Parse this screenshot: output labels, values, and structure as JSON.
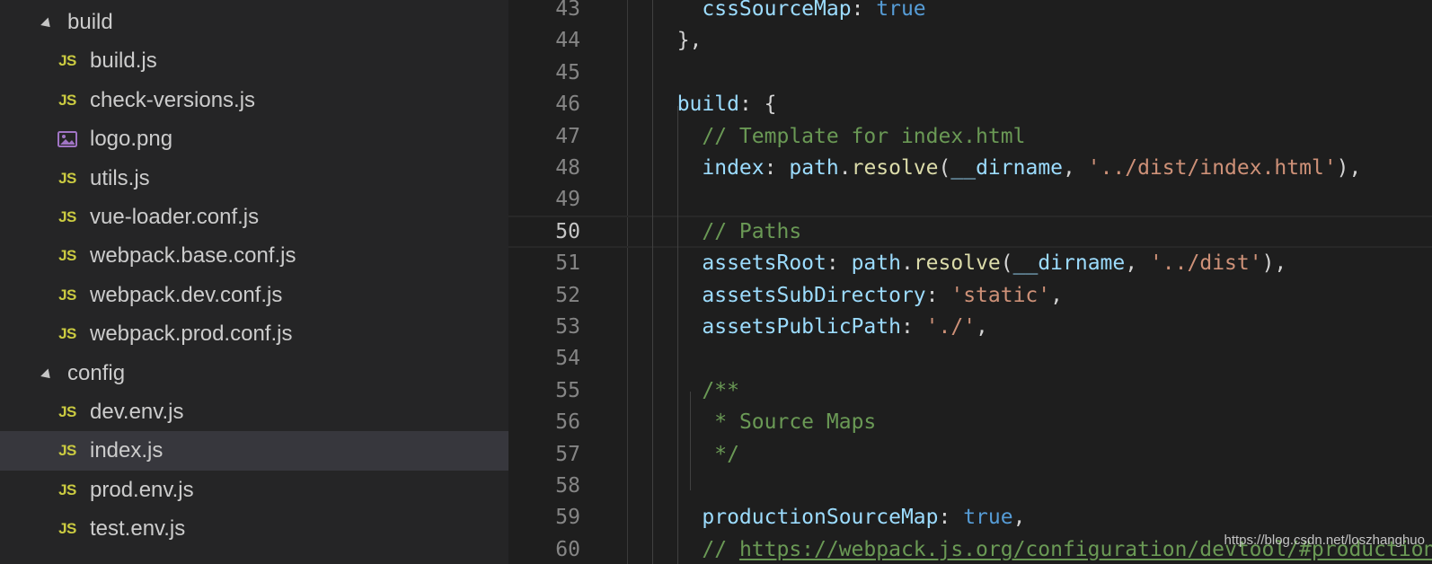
{
  "explorer": {
    "items": [
      {
        "type": "folder",
        "label": "build"
      },
      {
        "type": "js",
        "label": "build.js",
        "icon": "JS"
      },
      {
        "type": "js",
        "label": "check-versions.js",
        "icon": "JS"
      },
      {
        "type": "image",
        "label": "logo.png",
        "icon": "image-icon"
      },
      {
        "type": "js",
        "label": "utils.js",
        "icon": "JS"
      },
      {
        "type": "js",
        "label": "vue-loader.conf.js",
        "icon": "JS"
      },
      {
        "type": "js",
        "label": "webpack.base.conf.js",
        "icon": "JS"
      },
      {
        "type": "js",
        "label": "webpack.dev.conf.js",
        "icon": "JS"
      },
      {
        "type": "js",
        "label": "webpack.prod.conf.js",
        "icon": "JS"
      },
      {
        "type": "folder",
        "label": "config"
      },
      {
        "type": "js",
        "label": "dev.env.js",
        "icon": "JS"
      },
      {
        "type": "js",
        "label": "index.js",
        "icon": "JS",
        "selected": true
      },
      {
        "type": "js",
        "label": "prod.env.js",
        "icon": "JS"
      },
      {
        "type": "js",
        "label": "test.env.js",
        "icon": "JS"
      }
    ]
  },
  "editor": {
    "current_line": "50",
    "lines": [
      {
        "n": "43",
        "tokens": [
          [
            "    ",
            "plain"
          ],
          [
            "cssSourceMap",
            "prop"
          ],
          [
            ": ",
            "plain"
          ],
          [
            "true",
            "kw"
          ]
        ]
      },
      {
        "n": "44",
        "tokens": [
          [
            "  },",
            "plain"
          ]
        ]
      },
      {
        "n": "45",
        "tokens": []
      },
      {
        "n": "46",
        "tokens": [
          [
            "  ",
            "plain"
          ],
          [
            "build",
            "prop"
          ],
          [
            ": {",
            "plain"
          ]
        ]
      },
      {
        "n": "47",
        "tokens": [
          [
            "    ",
            "plain"
          ],
          [
            "// Template for index.html",
            "com"
          ]
        ]
      },
      {
        "n": "48",
        "tokens": [
          [
            "    ",
            "plain"
          ],
          [
            "index",
            "prop"
          ],
          [
            ": ",
            "plain"
          ],
          [
            "path",
            "prop"
          ],
          [
            ".",
            "plain"
          ],
          [
            "resolve",
            "func"
          ],
          [
            "(",
            "plain"
          ],
          [
            "__dirname",
            "prop"
          ],
          [
            ", ",
            "plain"
          ],
          [
            "'../dist/index.html'",
            "str"
          ],
          [
            "),",
            "plain"
          ]
        ]
      },
      {
        "n": "49",
        "tokens": []
      },
      {
        "n": "50",
        "tokens": [
          [
            "    ",
            "plain"
          ],
          [
            "// Paths",
            "com"
          ]
        ]
      },
      {
        "n": "51",
        "tokens": [
          [
            "    ",
            "plain"
          ],
          [
            "assetsRoot",
            "prop"
          ],
          [
            ": ",
            "plain"
          ],
          [
            "path",
            "prop"
          ],
          [
            ".",
            "plain"
          ],
          [
            "resolve",
            "func"
          ],
          [
            "(",
            "plain"
          ],
          [
            "__dirname",
            "prop"
          ],
          [
            ", ",
            "plain"
          ],
          [
            "'../dist'",
            "str"
          ],
          [
            "),",
            "plain"
          ]
        ]
      },
      {
        "n": "52",
        "tokens": [
          [
            "    ",
            "plain"
          ],
          [
            "assetsSubDirectory",
            "prop"
          ],
          [
            ": ",
            "plain"
          ],
          [
            "'static'",
            "str"
          ],
          [
            ",",
            "plain"
          ]
        ]
      },
      {
        "n": "53",
        "tokens": [
          [
            "    ",
            "plain"
          ],
          [
            "assetsPublicPath",
            "prop"
          ],
          [
            ": ",
            "plain"
          ],
          [
            "'./'",
            "str"
          ],
          [
            ",",
            "plain"
          ]
        ]
      },
      {
        "n": "54",
        "tokens": []
      },
      {
        "n": "55",
        "tokens": [
          [
            "    ",
            "plain"
          ],
          [
            "/**",
            "com"
          ]
        ]
      },
      {
        "n": "56",
        "tokens": [
          [
            "     ",
            "plain"
          ],
          [
            "* Source Maps",
            "com"
          ]
        ]
      },
      {
        "n": "57",
        "tokens": [
          [
            "     ",
            "plain"
          ],
          [
            "*/",
            "com"
          ]
        ]
      },
      {
        "n": "58",
        "tokens": []
      },
      {
        "n": "59",
        "tokens": [
          [
            "    ",
            "plain"
          ],
          [
            "productionSourceMap",
            "prop"
          ],
          [
            ": ",
            "plain"
          ],
          [
            "true",
            "kw"
          ],
          [
            ",",
            "plain"
          ]
        ]
      },
      {
        "n": "60",
        "tokens": [
          [
            "    ",
            "plain"
          ],
          [
            "// ",
            "com"
          ],
          [
            "https://webpack.js.org/configuration/devtool/#production",
            "link"
          ]
        ]
      }
    ]
  },
  "watermark": "https://blog.csdn.net/loszhanghuo",
  "colors": {
    "sidebar_bg": "#252526",
    "editor_bg": "#1e1e1e",
    "selection": "#37373d",
    "js_icon": "#cbcb41",
    "image_icon": "#a074c4"
  }
}
